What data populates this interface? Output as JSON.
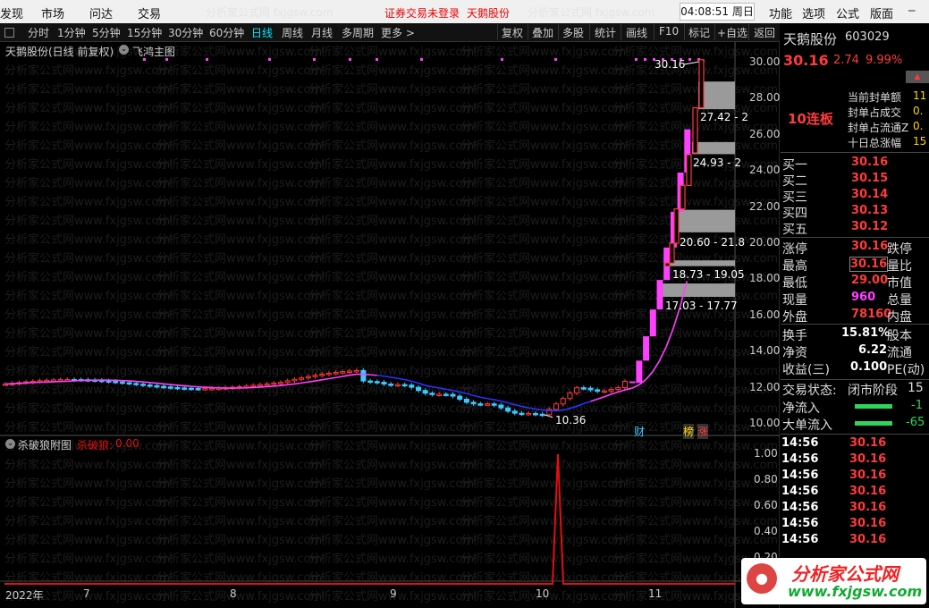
{
  "menu": {
    "items": [
      "发现",
      "市场",
      "问达",
      "交易"
    ],
    "status": "证券交易未登录",
    "stock": "天鹅股份",
    "watermark": "分析家公式网 fxjgsw.com",
    "clock": "04:08:51 周日",
    "right": [
      "功能",
      "选项",
      "公式",
      "版面"
    ]
  },
  "toolbar": {
    "periods": [
      "分时",
      "1分钟",
      "5分钟",
      "15分钟",
      "30分钟",
      "60分钟",
      "日线",
      "周线",
      "月线",
      "多周期",
      "更多 >"
    ],
    "selected": "日线",
    "tools": [
      "复权",
      "叠加",
      "多股",
      "统计",
      "画线",
      "F10",
      "标记",
      "+自选",
      "返回"
    ]
  },
  "main_chart": {
    "title": "天鹅股份(日线 前复权)",
    "indicator": "飞鸿主图",
    "y_ticks": [
      "30.00",
      "28.00",
      "26.00",
      "24.00",
      "22.00",
      "20.00",
      "18.00",
      "16.00",
      "14.00",
      "12.00",
      "10.00"
    ],
    "zones": [
      "27.42 - 2",
      "24.93 - 2",
      "20.60 - 21.8",
      "18.73 - 19.05",
      "17.03 - 17.77"
    ],
    "high_label": "30.16",
    "low_label": "10.36",
    "badges": [
      "财",
      "榜",
      "涨"
    ],
    "watermark_text": "分析家公式网www.fxjgsw.com"
  },
  "sub_chart": {
    "title": "杀破狼附图",
    "label": "杀破狼:",
    "value": "0.00",
    "y_ticks": [
      "1.00",
      "0.80",
      "0.60",
      "0.40",
      "0.20"
    ],
    "x_labels": [
      "2022年",
      "7",
      "8",
      "9",
      "10",
      "11"
    ]
  },
  "quote": {
    "name": "天鹅股份",
    "code": "603029",
    "price": "30.16",
    "change": "2.74",
    "pct": "9.99%",
    "tag": "10连板",
    "limit_info": [
      {
        "label": "当前封单额",
        "value": "11"
      },
      {
        "label": "封单占成交",
        "value": "0."
      },
      {
        "label": "封单占流通Z",
        "value": "0."
      },
      {
        "label": "十日总涨幅",
        "value": "15"
      }
    ],
    "bids": [
      {
        "label": "买一",
        "price": "30.16"
      },
      {
        "label": "买二",
        "price": "30.15"
      },
      {
        "label": "买三",
        "price": "30.14"
      },
      {
        "label": "买四",
        "price": "30.13"
      },
      {
        "label": "买五",
        "price": "30.12"
      }
    ],
    "stats_left": [
      {
        "label": "涨停",
        "value": "30.16"
      },
      {
        "label": "最高",
        "value": "30.16"
      },
      {
        "label": "最低",
        "value": "29.00"
      },
      {
        "label": "现量",
        "value": "960"
      },
      {
        "label": "外盘",
        "value": "78160"
      }
    ],
    "stats_right": [
      "跌停",
      "量比",
      "市值",
      "总量",
      "内盘"
    ],
    "fund": [
      {
        "label": "换手",
        "value": "15.81%",
        "right": "股本"
      },
      {
        "label": "净资",
        "value": "6.22",
        "right": "流通"
      },
      {
        "label": "收益(三)",
        "value": "0.100",
        "right": "PE(动)"
      }
    ],
    "trade_state_label": "交易状态:",
    "trade_state": "闭市阶段",
    "trade_state_extra": "15",
    "flows": [
      {
        "label": "净流入",
        "value": "-1"
      },
      {
        "label": "大单流入",
        "value": "-65"
      }
    ],
    "ticks": [
      {
        "time": "14:56",
        "price": "30.16"
      },
      {
        "time": "14:56",
        "price": "30.16"
      },
      {
        "time": "14:56",
        "price": "30.16"
      },
      {
        "time": "14:56",
        "price": "30.16"
      },
      {
        "time": "14:56",
        "price": "30.16"
      },
      {
        "time": "14:56",
        "price": "30.16"
      },
      {
        "time": "14:56",
        "price": "30.16"
      },
      {
        "time": "14:56",
        "price": "30.16"
      }
    ]
  },
  "logo": {
    "text": "分析家公式网",
    "url": "www.fxjgsw.com"
  },
  "colors": {
    "up": "#ff3b3b",
    "down": "#3cc8ff",
    "ma_up": "#ff40ff",
    "ma_down": "#2a32ff",
    "zone": "#9a9a9a",
    "line": "#e01010"
  }
}
